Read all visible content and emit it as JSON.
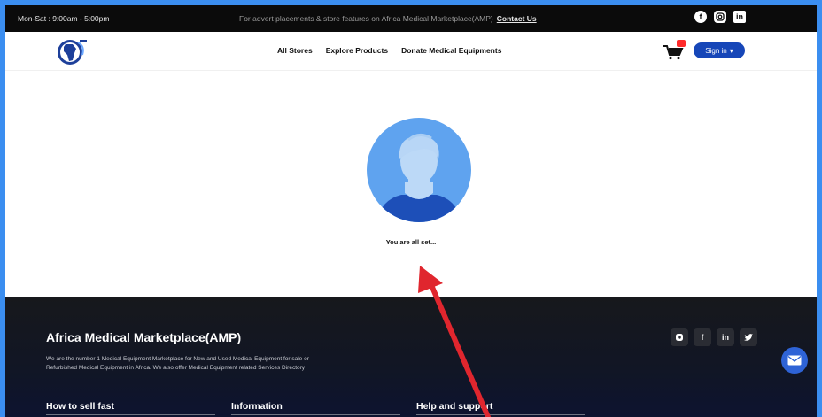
{
  "topbar": {
    "hours": "Mon-Sat : 9:00am - 5:00pm",
    "advert": "For advert placements & store features on Africa Medical Marketplace(AMP)",
    "contact": "Contact Us",
    "social": [
      "facebook-icon",
      "instagram-icon",
      "linkedin-icon"
    ]
  },
  "header": {
    "nav": [
      "All Stores",
      "Explore Products",
      "Donate Medical Equipments"
    ],
    "signin": "Sign in",
    "accent": "#1646b8",
    "badge_color": "#ff2a2a"
  },
  "main": {
    "status": "You are all set..."
  },
  "footer": {
    "title": "Africa Medical Marketplace(AMP)",
    "description": "We are the number 1 Medical Equipment Marketplace for New and Used Medical Equipment for sale or Refurbished Medical Equipment in Africa. We also offer Medical Equipment related Services Directory",
    "social": [
      "instagram-icon",
      "facebook-icon",
      "linkedin-icon",
      "twitter-icon"
    ],
    "headings": [
      "How to sell fast",
      "Information",
      "Help and support"
    ]
  }
}
